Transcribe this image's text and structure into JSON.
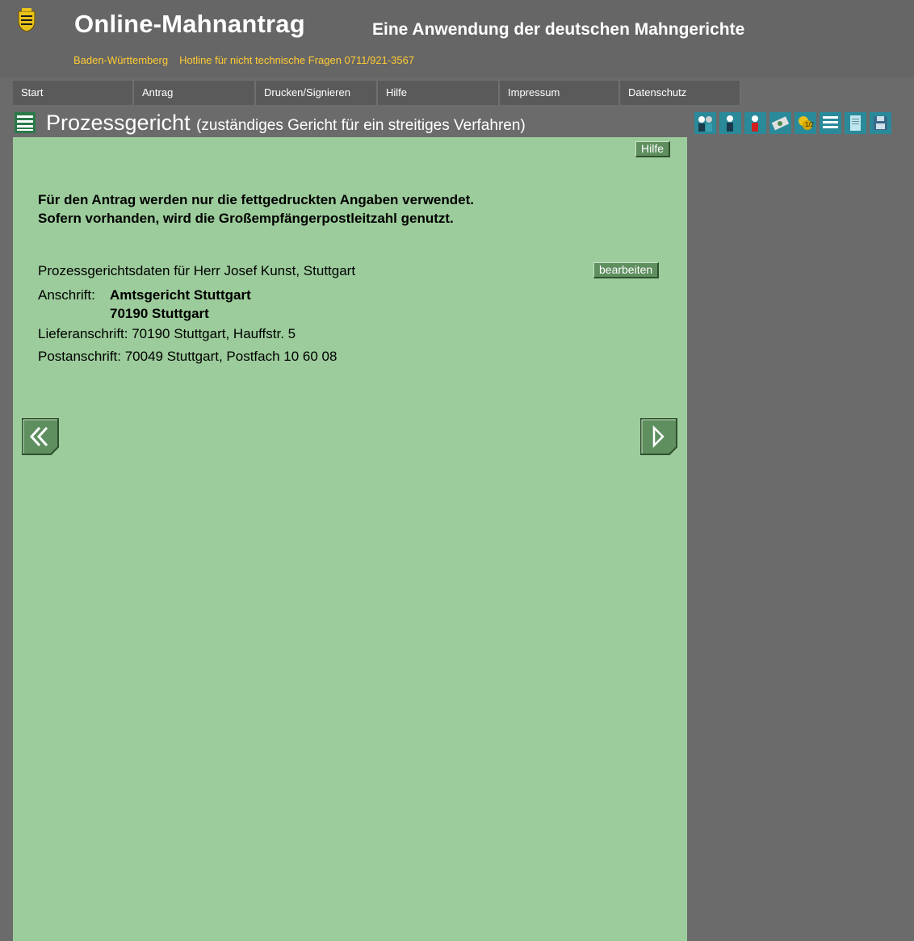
{
  "header": {
    "title": "Online-Mahnantrag",
    "subtitle": "Eine Anwendung der deutschen Mahngerichte",
    "state": "Baden-Württemberg",
    "hotline": "Hotline für nicht technische Fragen 0711/921-3567"
  },
  "nav": [
    {
      "label": "Start"
    },
    {
      "label": "Antrag"
    },
    {
      "label": "Drucken/Signieren"
    },
    {
      "label": "Hilfe"
    },
    {
      "label": "Impressum"
    },
    {
      "label": "Datenschutz"
    }
  ],
  "page": {
    "title": "Prozessgericht",
    "subtitle": "(zuständiges Gericht für ein streitiges Verfahren)"
  },
  "toolbar_icons": [
    "persons-icon",
    "person-icon",
    "person-red-icon",
    "money-icon",
    "coins-icon",
    "list-icon",
    "document-icon",
    "save-icon"
  ],
  "content": {
    "help_label": "Hilfe",
    "notice_line1": "Für den Antrag werden nur die fettgedruckten Angaben verwendet.",
    "notice_line2": "Sofern vorhanden, wird die Großempfängerpostleitzahl genutzt.",
    "court_heading": "Prozessgerichtsdaten für Herr Josef Kunst, Stuttgart",
    "edit_label": "bearbeiten",
    "address_label": "Anschrift:",
    "court_name": "Amtsgericht Stuttgart",
    "court_zip_city": "70190 Stuttgart",
    "delivery_address": "Lieferanschrift: 70190 Stuttgart, Hauffstr. 5",
    "postal_address": "Postanschrift: 70049 Stuttgart, Postfach 10 60 08"
  },
  "colors": {
    "background": "#6b6b6b",
    "panel": "#9ccc9b",
    "accent": "#ffcc33",
    "button": "#5f8f5f"
  }
}
